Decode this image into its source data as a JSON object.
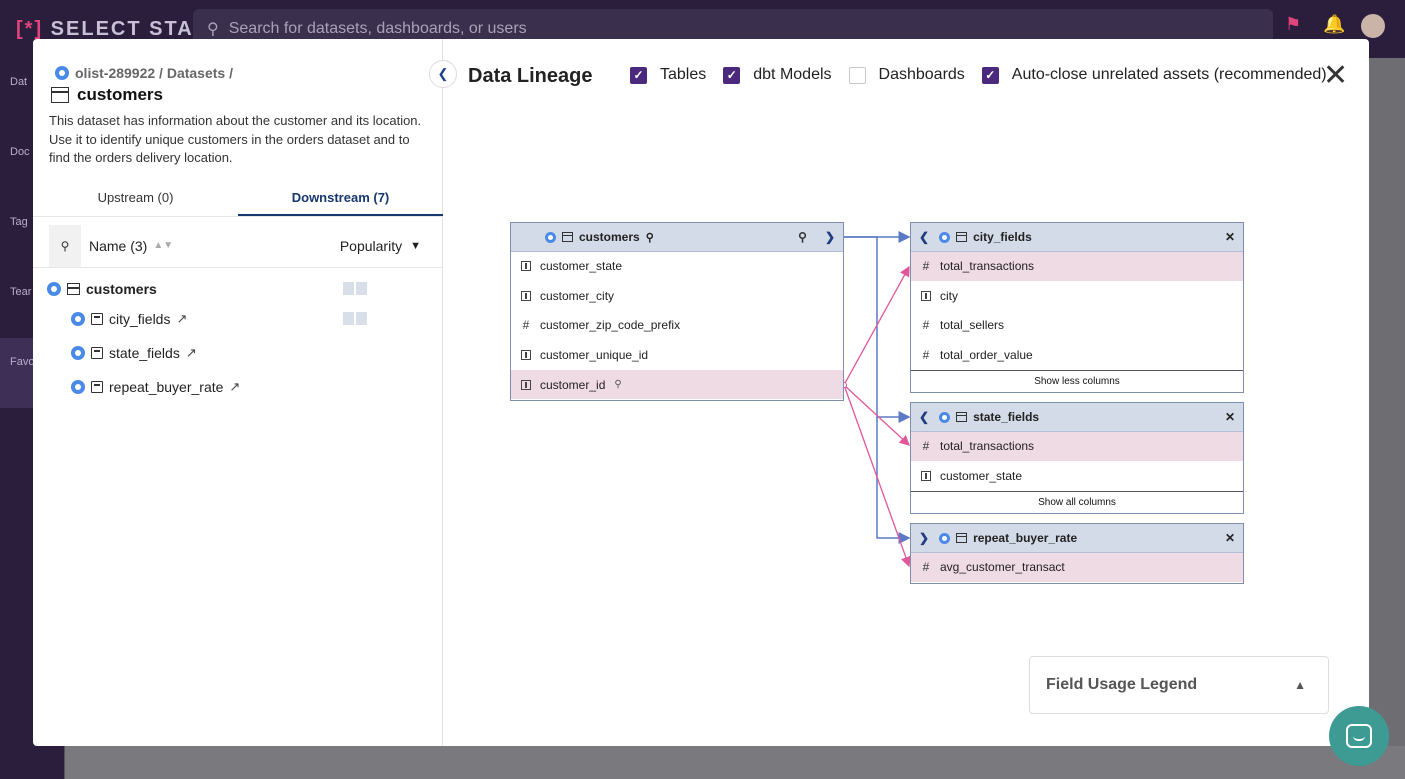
{
  "app": {
    "brand_mark": "[*]",
    "brand_name": "SELECT STAR",
    "search_placeholder": "Search for datasets, dashboards, or users",
    "nav": [
      {
        "label": "Dat"
      },
      {
        "label": "Doc"
      },
      {
        "label": "Tag"
      },
      {
        "label": "Tear"
      },
      {
        "label": "Favor"
      }
    ]
  },
  "dataset": {
    "breadcrumb": "olist-289922 / Datasets /",
    "title": "customers",
    "description": "This dataset has information about the customer and its location. Use it to identify unique customers in the orders dataset and to find the orders delivery location."
  },
  "tabs": [
    {
      "label": "Upstream (0)"
    },
    {
      "label": "Downstream (7)"
    }
  ],
  "list_header": {
    "name_label": "Name (3)",
    "sort_label": "Popularity"
  },
  "tree": {
    "root": "customers",
    "children": [
      {
        "label": "city_fields"
      },
      {
        "label": "state_fields"
      },
      {
        "label": "repeat_buyer_rate"
      }
    ]
  },
  "lineage": {
    "title": "Data Lineage",
    "options": [
      {
        "label": "Tables",
        "checked": true
      },
      {
        "label": "dbt Models",
        "checked": true
      },
      {
        "label": "Dashboards",
        "checked": false
      },
      {
        "label": "Auto-close unrelated assets (recommended)",
        "checked": true
      }
    ],
    "source_node": {
      "title": "customers",
      "columns": [
        {
          "name": "customer_state",
          "type": "text"
        },
        {
          "name": "customer_city",
          "type": "text"
        },
        {
          "name": "customer_zip_code_prefix",
          "type": "number"
        },
        {
          "name": "customer_unique_id",
          "type": "text"
        },
        {
          "name": "customer_id",
          "type": "text"
        }
      ]
    },
    "target_nodes": [
      {
        "title": "city_fields",
        "columns": [
          {
            "name": "total_transactions",
            "type": "number"
          },
          {
            "name": "city",
            "type": "text"
          },
          {
            "name": "total_sellers",
            "type": "number"
          },
          {
            "name": "total_order_value",
            "type": "number"
          }
        ],
        "footer": "Show less columns"
      },
      {
        "title": "state_fields",
        "columns": [
          {
            "name": "total_transactions",
            "type": "number"
          },
          {
            "name": "customer_state",
            "type": "text"
          }
        ],
        "footer": "Show all columns"
      },
      {
        "title": "repeat_buyer_rate",
        "columns": [
          {
            "name": "avg_customer_transact",
            "type": "number"
          }
        ]
      }
    ],
    "legend_title": "Field Usage Legend"
  },
  "colors": {
    "accent": "#4b2a7e",
    "node_header": "#d4dbe8",
    "highlight_row": "#efdbe4",
    "edge_pink": "#e0579a",
    "edge_blue": "#5b79c4"
  }
}
